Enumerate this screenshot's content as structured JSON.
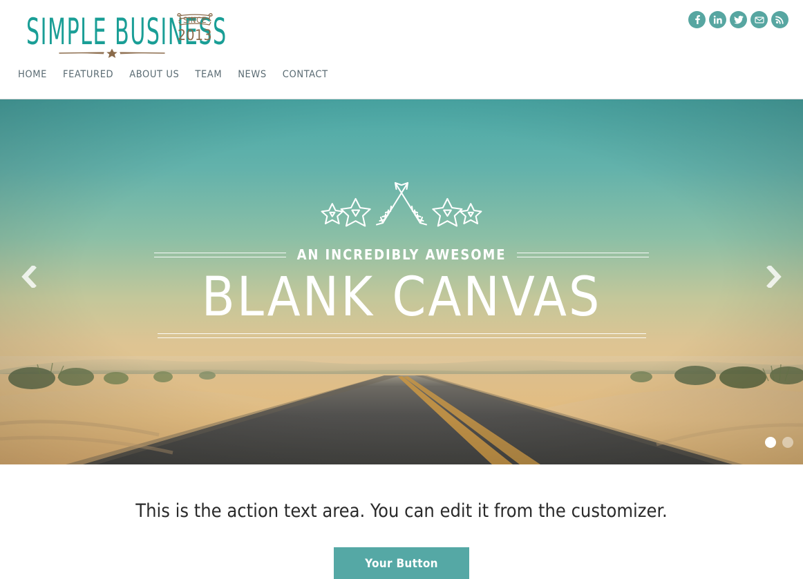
{
  "site": {
    "logo_text": "SIMPLE BUSINESS",
    "badge_since_label": "SINCE",
    "badge_year": "2013",
    "logo_color": "#1a9e96",
    "accent_color": "#55a8a5"
  },
  "social": {
    "items": [
      {
        "name": "facebook",
        "icon": "facebook-icon",
        "label": "Facebook"
      },
      {
        "name": "linkedin",
        "icon": "linkedin-icon",
        "label": "LinkedIn"
      },
      {
        "name": "twitter",
        "icon": "twitter-icon",
        "label": "Twitter"
      },
      {
        "name": "email",
        "icon": "email-icon",
        "label": "Email"
      },
      {
        "name": "rss",
        "icon": "rss-icon",
        "label": "RSS"
      }
    ]
  },
  "nav": {
    "items": [
      {
        "label": "HOME"
      },
      {
        "label": "FEATURED"
      },
      {
        "label": "ABOUT US"
      },
      {
        "label": "TEAM"
      },
      {
        "label": "NEWS"
      },
      {
        "label": "CONTACT"
      }
    ]
  },
  "hero": {
    "kicker": "AN INCREDIBLY AWESOME",
    "title": "BLANK CANVAS",
    "emblem": "crossed-arrows-and-stars",
    "prev_label": "Previous",
    "next_label": "Next",
    "slides": [
      {
        "index": 1,
        "active": true
      },
      {
        "index": 2,
        "active": false
      }
    ]
  },
  "action": {
    "text": "This is the action text area. You can edit it from the customizer.",
    "button_label": "Your Button"
  }
}
